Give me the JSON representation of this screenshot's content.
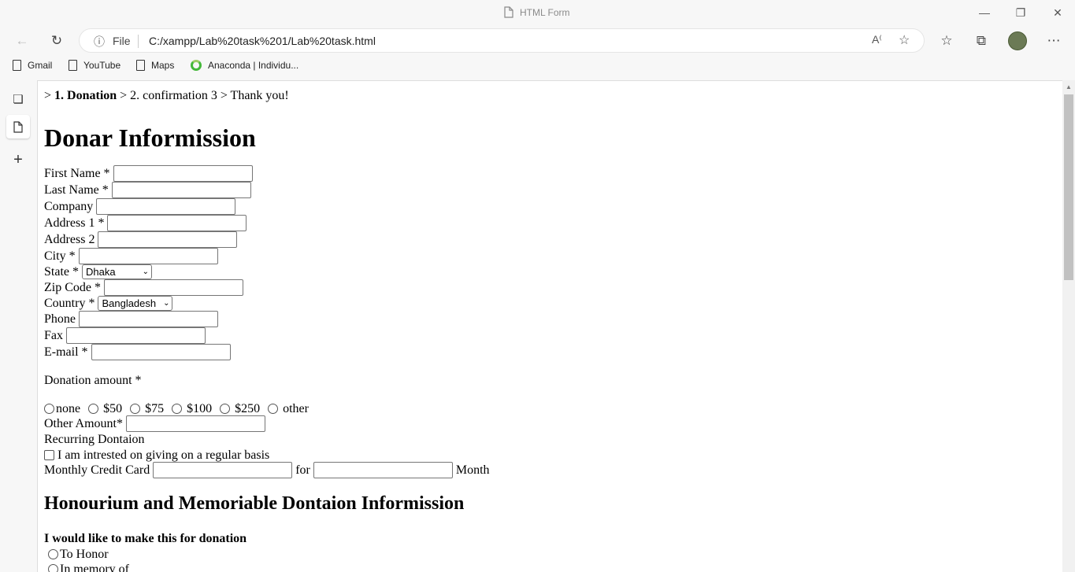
{
  "browser": {
    "tab_title": "HTML Form",
    "address_scheme": "File",
    "url": "C:/xampp/Lab%20task%201/Lab%20task.html",
    "bookmarks": [
      {
        "label": "Gmail",
        "icon": "page-icon"
      },
      {
        "label": "YouTube",
        "icon": "page-icon"
      },
      {
        "label": "Maps",
        "icon": "page-icon"
      },
      {
        "label": "Anaconda | Individu...",
        "icon": "anaconda-icon"
      }
    ]
  },
  "page": {
    "breadcrumb": {
      "prefix": ">",
      "current": "1. Donation",
      "rest": "> 2. confirmation 3 > Thank you!"
    },
    "heading": "Donar Informission",
    "fields": {
      "first_name": "First Name *",
      "last_name": "Last Name *",
      "company": "Company",
      "address1": "Address 1 *",
      "address2": "Address 2",
      "city": "City *",
      "state": "State *",
      "state_value": "Dhaka",
      "zip": "Zip Code *",
      "country": "Country *",
      "country_value": "Bangladesh",
      "phone": "Phone",
      "fax": "Fax",
      "email": "E-mail *"
    },
    "donation": {
      "label": "Donation amount *",
      "options": [
        "none",
        "$50",
        "$75",
        "$100",
        "$250",
        "other"
      ],
      "other_amount": "Other Amount*",
      "recurring": "Recurring Dontaion",
      "recurring_check": "I am intrested on giving on a regular basis",
      "monthly": "Monthly Credit Card",
      "for": "for",
      "month": "Month"
    },
    "honour": {
      "heading": "Honourium and Memoriable Dontaion Informission",
      "subheading": "I would like to make this for donation",
      "options": [
        "To Honor",
        "In memory of"
      ]
    }
  }
}
